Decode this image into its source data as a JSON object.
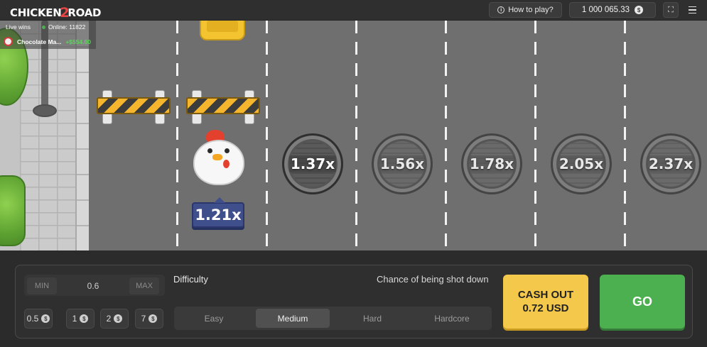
{
  "header": {
    "logo_text": "CHICKEN",
    "logo_two": "2",
    "logo_road": "ROAD",
    "howto_label": "How to play?",
    "balance": "1 000 065.33",
    "currency_symbol": "$"
  },
  "live": {
    "label": "Live wins",
    "online": "Online: 11822",
    "last_winner": "Chocolate Ma...",
    "last_win_amount": "+$554.00"
  },
  "game": {
    "current_multiplier": "1.21x",
    "multipliers": [
      "1.37x",
      "1.56x",
      "1.78x",
      "2.05x",
      "2.37x"
    ]
  },
  "bet": {
    "min_label": "MIN",
    "max_label": "MAX",
    "value": "0.6",
    "chips": [
      "0.5",
      "1",
      "2",
      "7"
    ]
  },
  "controls": {
    "difficulty_label": "Difficulty",
    "chance_label": "Chance of being shot down",
    "difficulties": [
      "Easy",
      "Medium",
      "Hard",
      "Hardcore"
    ],
    "selected_difficulty": "Medium",
    "cashout_line1": "CASH OUT",
    "cashout_line2": "0.72 USD",
    "go_label": "GO"
  },
  "colors": {
    "cashout": "#f4c84a",
    "go": "#4caf50",
    "multiplier_badge": "#3f4f8c"
  }
}
